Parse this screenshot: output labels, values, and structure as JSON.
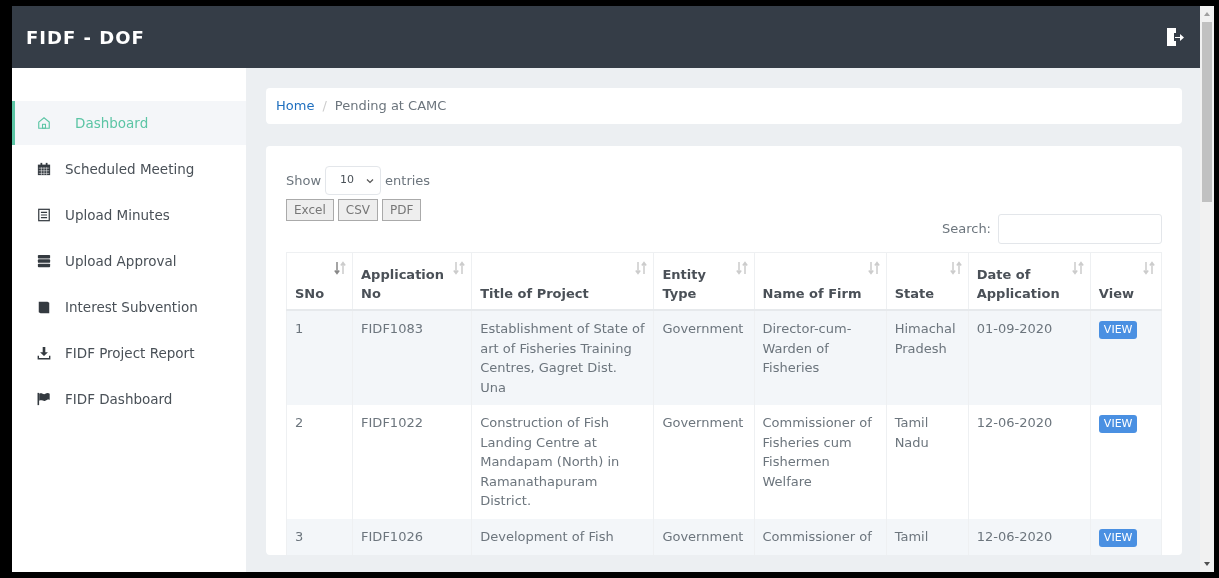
{
  "app": {
    "title": "FIDF - DOF"
  },
  "sidebar": {
    "items": [
      {
        "label": "Dashboard",
        "selected": true
      },
      {
        "label": "Scheduled Meeting",
        "selected": false
      },
      {
        "label": "Upload Minutes",
        "selected": false
      },
      {
        "label": "Upload Approval",
        "selected": false
      },
      {
        "label": "Interest Subvention",
        "selected": false
      },
      {
        "label": "FIDF Project Report",
        "selected": false
      },
      {
        "label": "FIDF Dashboard",
        "selected": false
      }
    ]
  },
  "breadcrumb_separator": "/",
  "breadcrumb": [
    {
      "label": "Home",
      "kind": "link"
    },
    {
      "label": "Pending at CAMC",
      "kind": "current"
    }
  ],
  "length_menu": {
    "label_before": "Show",
    "value": "10",
    "label_after": "entries"
  },
  "export_buttons": [
    "Excel",
    "CSV",
    "PDF"
  ],
  "search": {
    "label": "Search:"
  },
  "table": {
    "columns": [
      {
        "label": "SNo",
        "sorted": true
      },
      {
        "label": "Application No",
        "sorted": false
      },
      {
        "label": "Title of Project",
        "sorted": false
      },
      {
        "label": "Entity Type",
        "sorted": false
      },
      {
        "label": "Name of Firm",
        "sorted": false
      },
      {
        "label": "State",
        "sorted": false
      },
      {
        "label": "Date of Application",
        "sorted": false
      },
      {
        "label": "View",
        "sorted": false
      }
    ],
    "rows": [
      {
        "cells": [
          "1",
          "FIDF1083",
          "Establishment of State of art of Fisheries Training Centres, Gagret Dist. Una",
          "Government",
          "Director-cum-Warden of Fisheries",
          "Himachal Pradesh",
          "01-09-2020"
        ],
        "action": "VIEW"
      },
      {
        "cells": [
          "2",
          "FIDF1022",
          "Construction of Fish Landing Centre at Mandapam (North) in Ramanathapuram District.",
          "Government",
          "Commissioner of Fisheries cum Fishermen Welfare",
          "Tamil Nadu",
          "12-06-2020"
        ],
        "action": "VIEW"
      },
      {
        "cells": [
          "3",
          "FIDF1026",
          "Development of Fish",
          "Government",
          "Commissioner of",
          "Tamil",
          "12-06-2020"
        ],
        "action": "VIEW"
      }
    ]
  }
}
